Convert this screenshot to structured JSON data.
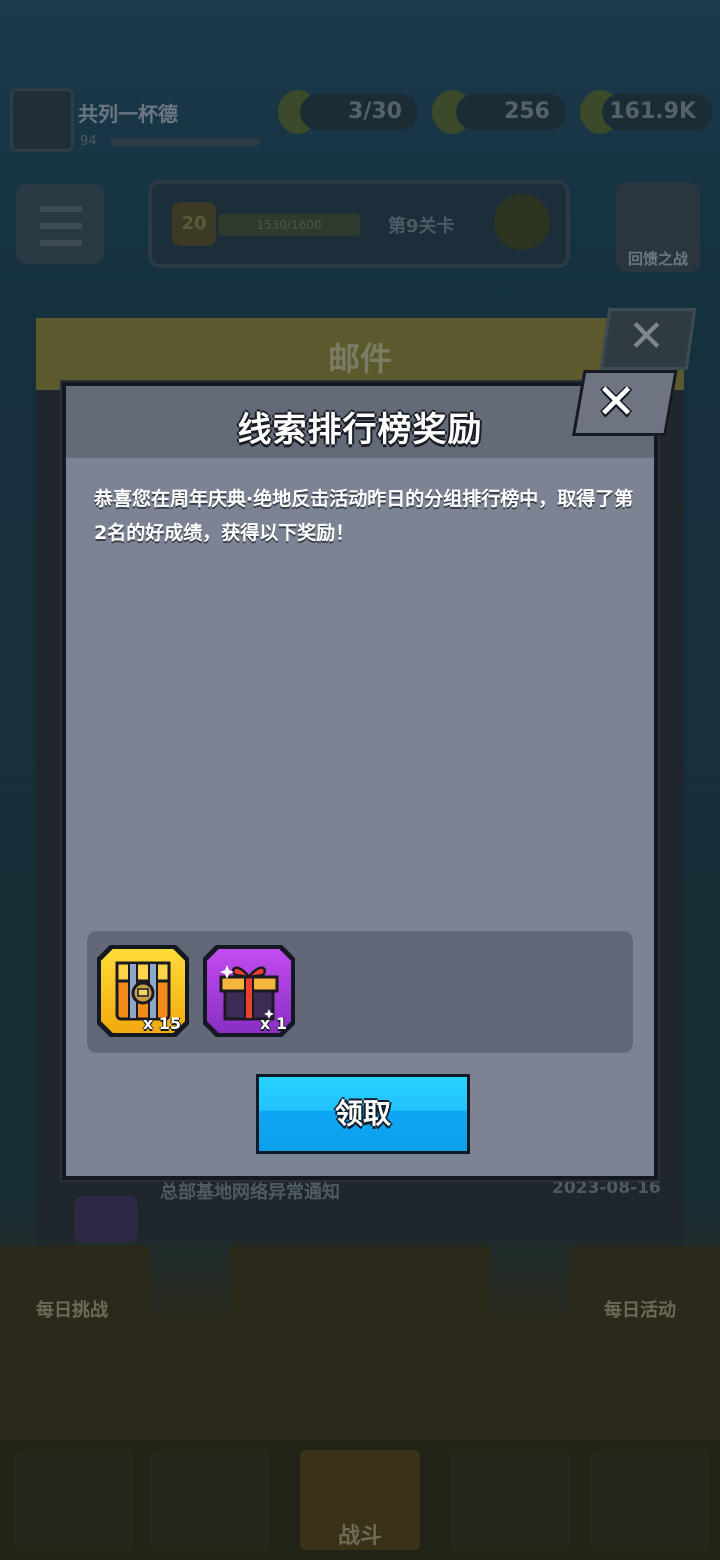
{
  "background": {
    "player": {
      "name": "共列一杯德",
      "level": "94"
    },
    "resources": [
      {
        "icon": "energy-icon",
        "value": "3/30"
      },
      {
        "icon": "gem-icon",
        "value": "256"
      },
      {
        "icon": "coin-icon",
        "value": "161.9K"
      }
    ],
    "level_panel": {
      "level": "20",
      "progress": "1530/1600",
      "stage_text": "第9关卡"
    },
    "shield_label": "回馈之战",
    "mail": {
      "title": "邮件",
      "item_title": "总部基地网络异常通知",
      "item_date": "2023-08-16"
    },
    "bottom": {
      "left_label": "每日挑战",
      "right_label": "每日活动"
    },
    "nav": {
      "active_label": "战斗"
    }
  },
  "dialog": {
    "title": "线索排行榜奖励",
    "message": "恭喜您在周年庆典·绝地反击活动昨日的分组排行榜中，取得了第2名的好成绩，获得以下奖励！",
    "rewards": [
      {
        "icon": "treasure-chest-icon",
        "quantity": "x 15",
        "color": "#f5b81a"
      },
      {
        "icon": "gift-box-icon",
        "quantity": "x 1",
        "color": "#a53ddc"
      }
    ],
    "claim_label": "领取",
    "close_icon": "close-icon"
  },
  "colors": {
    "dialog_bg": "#7c8494",
    "dialog_header": "#636a78",
    "claim_button": "#22c2ff"
  }
}
